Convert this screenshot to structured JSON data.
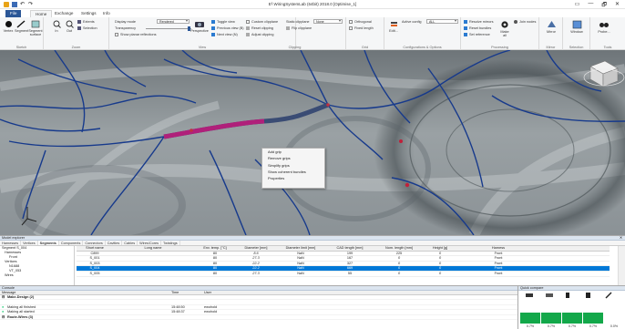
{
  "window": {
    "title": "E³.WiringSystemLab (64bit) 2018.0 [Optimise_1]",
    "controls": [
      "▭",
      "—",
      "🗗",
      "✕"
    ]
  },
  "ribbon_tabs": [
    "File",
    "Home",
    "Exchange",
    "Settings",
    "Info"
  ],
  "ribbon": {
    "sketch": {
      "label": "Sketch",
      "vertex": "Vertex",
      "segment": "Segment",
      "surface": "Segment surface"
    },
    "zoom": {
      "label": "Zoom",
      "in": "In",
      "out": "Out",
      "extents": "Extents",
      "selection": "Selection"
    },
    "view": {
      "label": "View",
      "display_mode_label": "Display mode",
      "display_mode_value": "Rendered",
      "transparency_label": "Transparency",
      "show_reflections": "Show planar reflections",
      "perspective": "Perspective",
      "toggle_view": "Toggle view",
      "previous_view": "Previous view (B)",
      "next_view": "Next view (N)"
    },
    "clipping": {
      "label": "Clipping",
      "custom_clipplane": "Custom clipplane",
      "static_clipplane": "Static clipplane",
      "clipplane_value": "None",
      "reset_clipping": "Reset clipping",
      "flip_clipplane": "Flip clipplane",
      "adjust_clipping": "Adjust clipping"
    },
    "grid": {
      "label": "Grid",
      "orthogonal": "Orthogonal",
      "fixed_length": "Fixed length"
    },
    "config": {
      "label": "Configurations & Options",
      "edit": "Edit...",
      "active_config_label": "Active config",
      "active_config_value": "ALL"
    },
    "processing": {
      "label": "Processing",
      "resolve_mirrors": "Resolve mirrors",
      "reset_bundles": "Reset bundles",
      "set_reference": "Set reference",
      "join_nodes": "Join nodes",
      "make": "Make",
      "all": "all"
    },
    "mirror": {
      "label": "Mirror",
      "button": "Mirror"
    },
    "selection": {
      "label": "Selection",
      "window": "Window"
    },
    "tools": {
      "label": "Tools",
      "probe": "Probe..."
    }
  },
  "context_menu": [
    "Add grip",
    "Remove grips",
    "Simplify grips",
    "Show coherent bundles",
    "Properties"
  ],
  "model_explorer": {
    "title": "Model explorer",
    "close": "✕",
    "tabs": [
      "Harnesses",
      "Vertices",
      "Segments",
      "Components",
      "Connectors",
      "Cavities",
      "Cables",
      "Wires/Cores",
      "Twistings"
    ],
    "tree": [
      "Segment S_004",
      "Harnesses",
      "Front",
      "Vertices",
      "N1688",
      "VT_053",
      "Wires"
    ],
    "columns": [
      "Short name",
      "Long name",
      "Env. temp. [°C]",
      "Diameter [mm]",
      "Diameter limit [mm]",
      "CAD length [mm]",
      "Nom. length [mm]",
      "Height [g]",
      "Harness"
    ],
    "rows": [
      [
        "C899",
        "",
        "80",
        "8.6",
        "NaN",
        "199",
        "225",
        "0",
        "Front"
      ],
      [
        "S_001",
        "",
        "80",
        "27.3",
        "NaN",
        "167",
        "0",
        "0",
        "Front"
      ],
      [
        "S_003",
        "",
        "80",
        "22.2",
        "NaN",
        "327",
        "0",
        "0",
        "Front"
      ],
      [
        "S_004",
        "",
        "80",
        "22.2",
        "NaN",
        "669",
        "0",
        "0",
        "Front"
      ],
      [
        "S_005",
        "",
        "80",
        "27.3",
        "NaN",
        "55",
        "0",
        "0",
        "Front"
      ]
    ]
  },
  "console": {
    "title": "Console",
    "columns": [
      "Message",
      "Time",
      "User"
    ],
    "rows": [
      {
        "type": "group",
        "message": "Make-Design (2)",
        "time": "",
        "user": ""
      },
      {
        "type": "item",
        "message": "",
        "time": "",
        "user": ""
      },
      {
        "type": "item",
        "message": "Making all finished",
        "time": "15:48:50",
        "user": "ewohold"
      },
      {
        "type": "item",
        "message": "Making all started",
        "time": "15:48:37",
        "user": "ewohold"
      },
      {
        "type": "group",
        "message": "Route-Wires (3)",
        "time": "",
        "user": ""
      }
    ]
  },
  "quick_compare": {
    "title": "Quick compare",
    "bars": [
      {
        "label": "0.7%",
        "fill": 0.55
      },
      {
        "label": "0.7%",
        "fill": 0.55
      },
      {
        "label": "0.7%",
        "fill": 0.55
      },
      {
        "label": "0.7%",
        "fill": 0.55
      },
      {
        "label": "0.0%",
        "fill": 0.0
      }
    ]
  },
  "colors": {
    "file_tab": "#2b5797",
    "selection": "#0078d7",
    "highlight_segment": "#b0207a",
    "quick_bar": "#13a84a"
  }
}
